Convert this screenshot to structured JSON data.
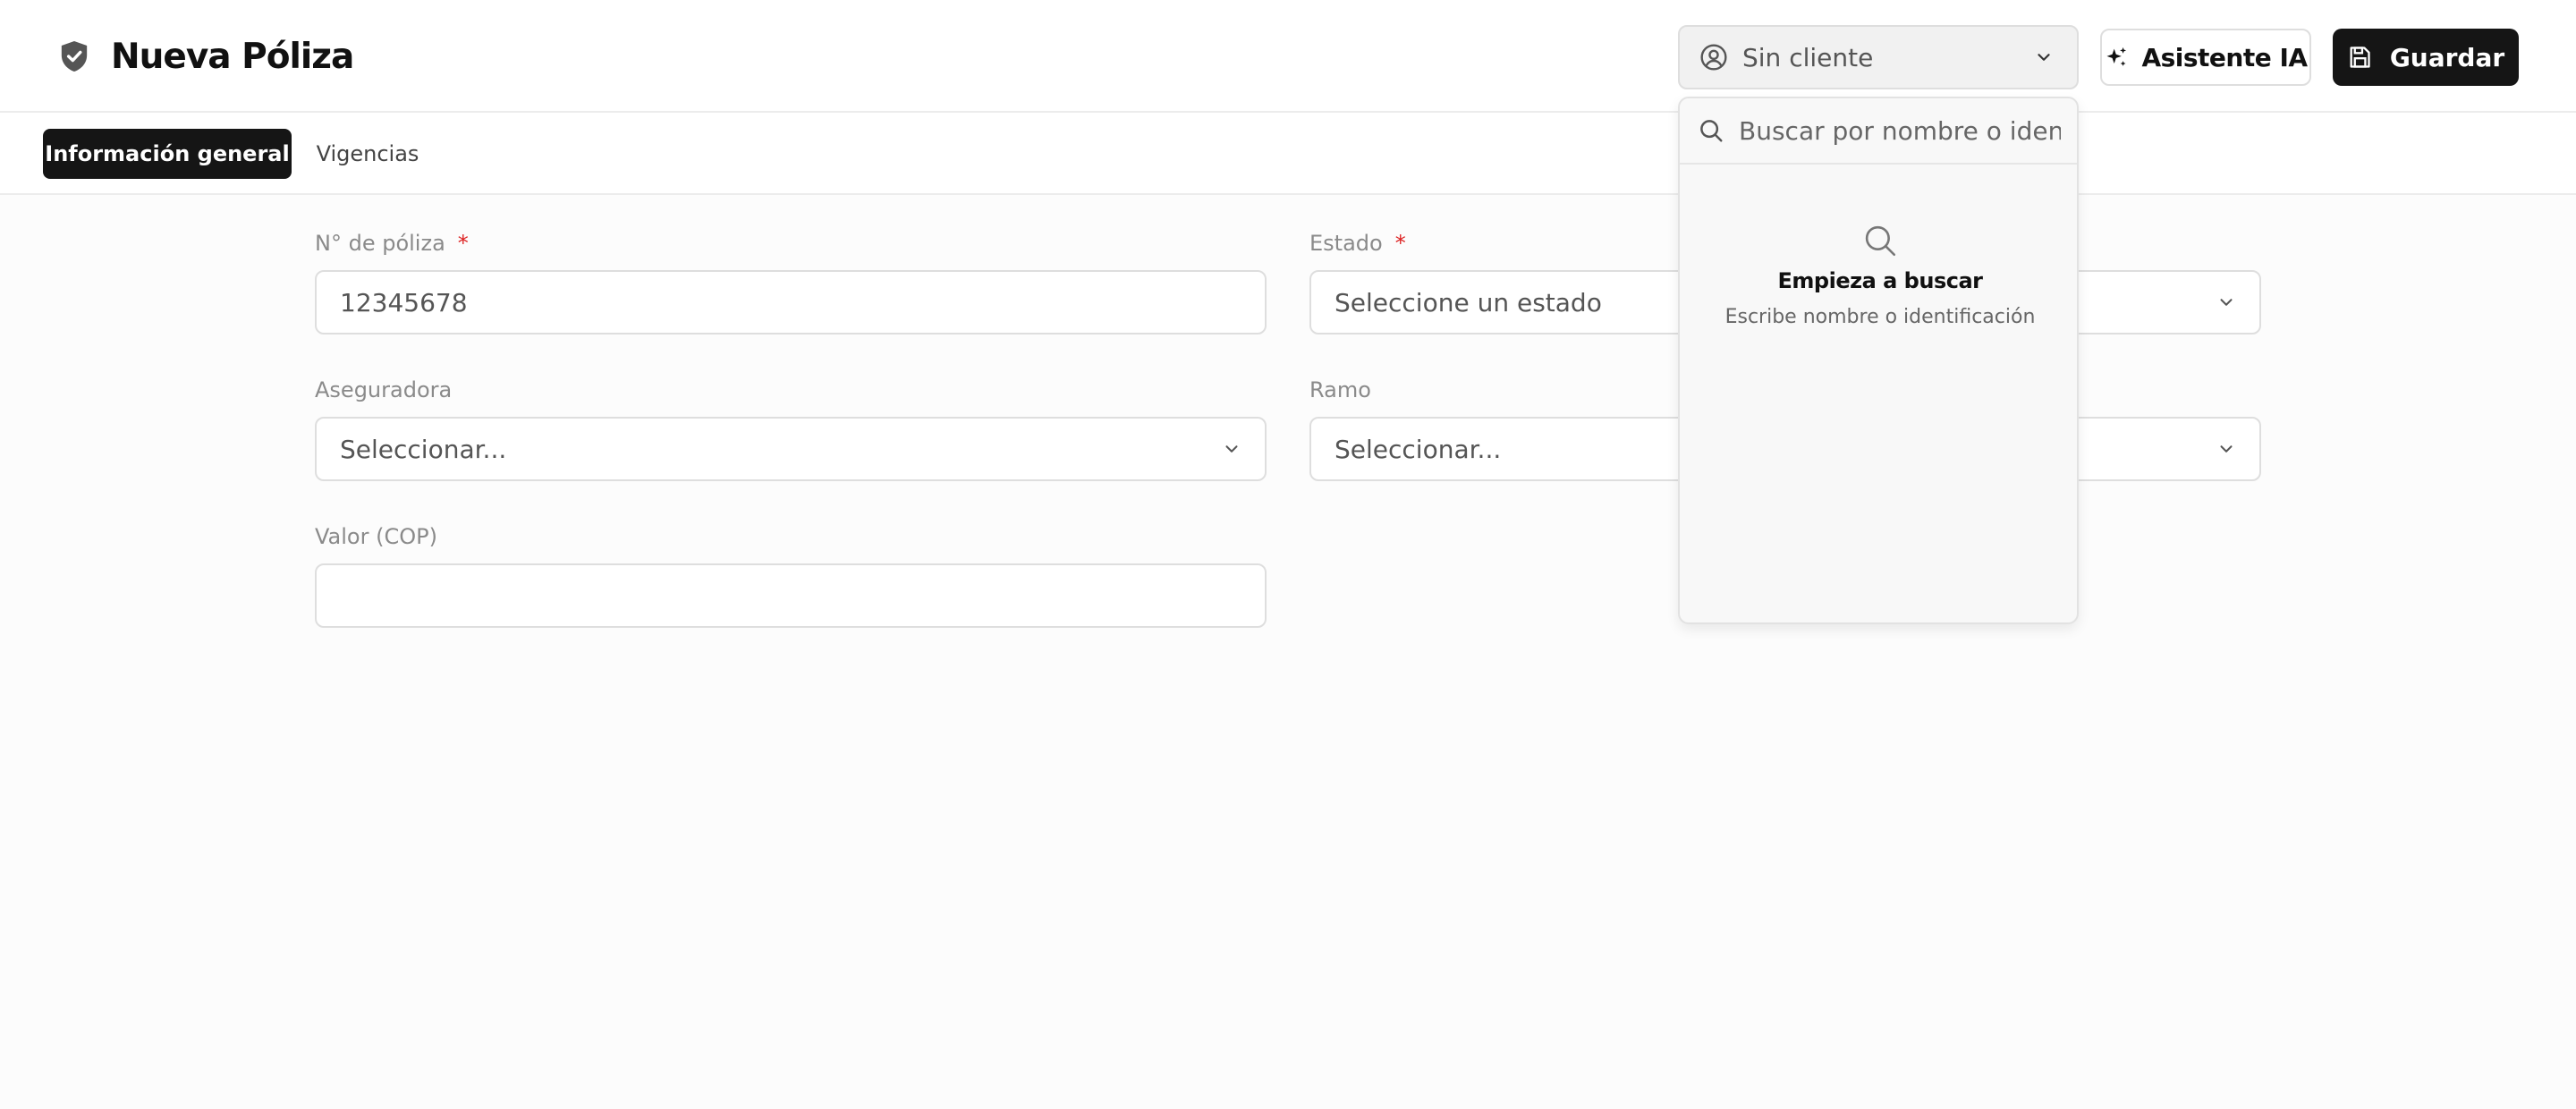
{
  "header": {
    "title": "Nueva Póliza",
    "title_icon": "shield-icon",
    "client_select": {
      "label": "Sin cliente",
      "icon": "user-circle-icon"
    },
    "ai_button": {
      "label": "Asistente IA",
      "icon": "sparkles-icon"
    },
    "save_button": {
      "label": "Guardar",
      "icon": "save-icon"
    }
  },
  "tabs": [
    {
      "label": "Información general",
      "active": true
    },
    {
      "label": "Vigencias",
      "active": false
    }
  ],
  "form": {
    "policy_number": {
      "label": "N° de póliza",
      "required_mark": "*",
      "value": "12345678"
    },
    "status": {
      "label": "Estado",
      "required_mark": "*",
      "value": "Seleccione un estado"
    },
    "insurer": {
      "label": "Aseguradora",
      "value": "Seleccionar..."
    },
    "branch": {
      "label": "Ramo",
      "value": "Seleccionar..."
    },
    "value_cop": {
      "label": "Valor (COP)",
      "value": ""
    }
  },
  "client_dropdown": {
    "search_placeholder": "Buscar por nombre o identificación...",
    "empty_title": "Empieza a buscar",
    "empty_subtitle": "Escribe nombre o identificación"
  },
  "colors": {
    "primary": "#151515",
    "required": "#dd2222",
    "border": "#dedede",
    "background": "#fcfcfc"
  }
}
